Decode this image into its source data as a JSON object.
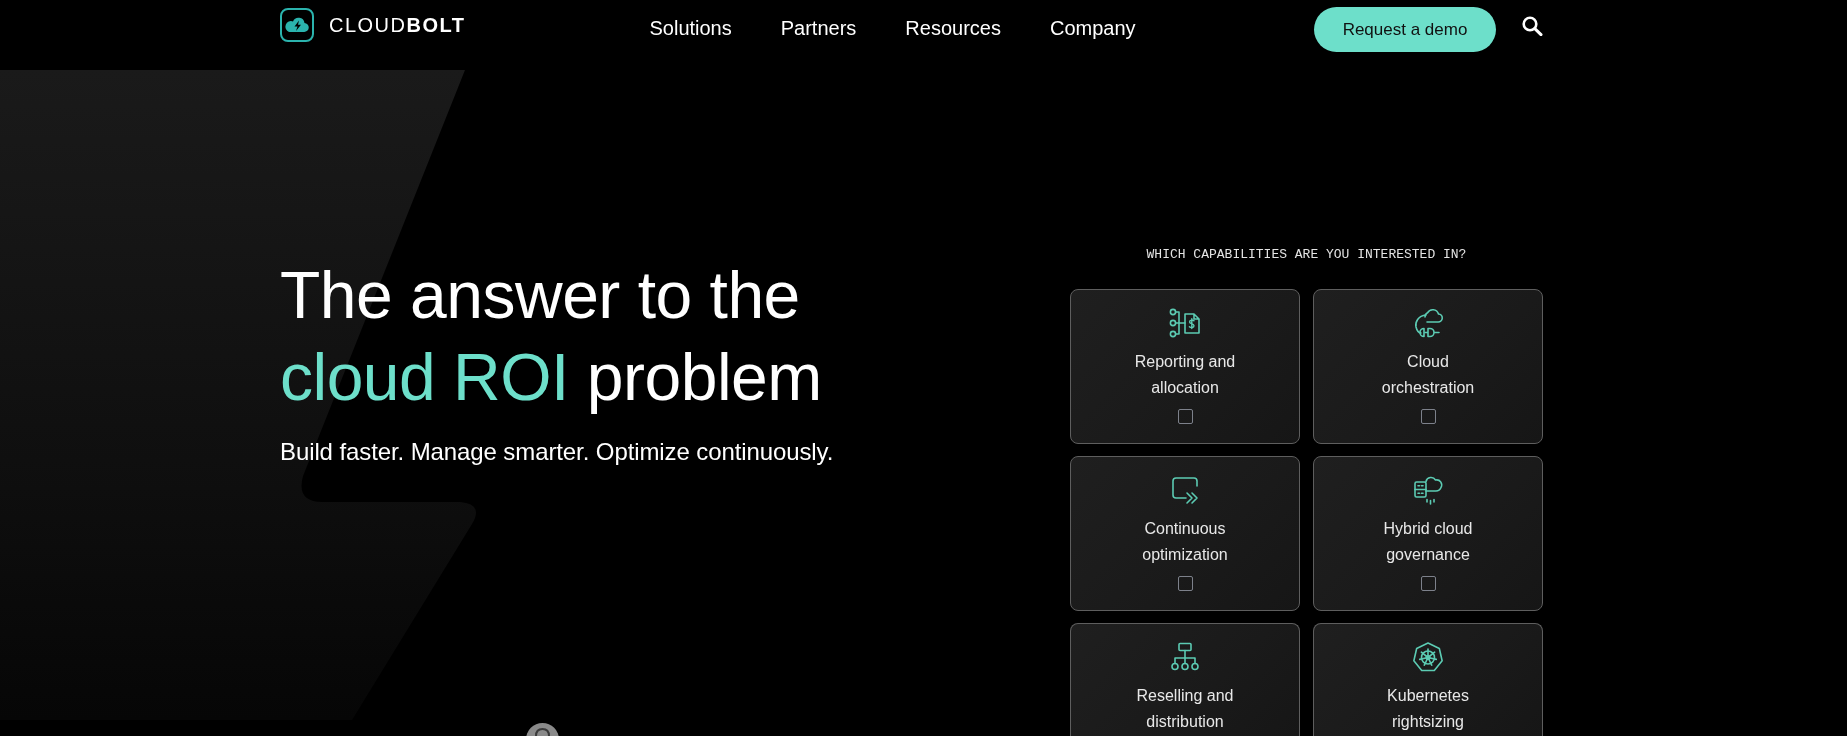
{
  "header": {
    "logo": "CLOUD**BOLT**",
    "nav": [
      "Solutions",
      "Partners",
      "Resources",
      "Company"
    ],
    "cta": "Request a demo"
  },
  "hero": {
    "headline": [
      {
        "text": "The answer to the",
        "highlight": false
      },
      {
        "text": "cloud ROI",
        "highlight": true
      },
      {
        "text": "problem",
        "highlight": false
      }
    ],
    "subtitle": "Build faster. Manage smarter. Optimize continuously."
  },
  "capabilities": {
    "prompt": "WHICH CAPABILITIES ARE YOU INTERESTED IN?",
    "cards": [
      {
        "label": "Reporting and allocation",
        "checked": false
      },
      {
        "label": "Cloud orchestration",
        "checked": false
      },
      {
        "label": "Continuous optimization",
        "checked": false
      },
      {
        "label": "Hybrid cloud governance",
        "checked": false
      },
      {
        "label": "Reselling and distribution"
      },
      {
        "label": "Kubernetes rightsizing"
      }
    ]
  }
}
